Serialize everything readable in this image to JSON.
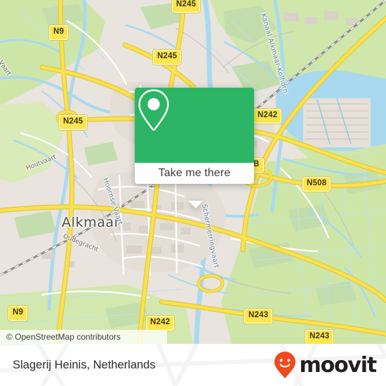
{
  "map": {
    "attribution": "© OpenStreetMap contributors",
    "city_label": "Alkmaar",
    "water_labels": [
      {
        "name": "Kanaal Alkmaar-Kolhorn"
      },
      {
        "name": "Schermerringvaart"
      },
      {
        "name": "Hoornse Vaart"
      },
      {
        "name": "Oudegracht"
      },
      {
        "name": "Houtvaart"
      },
      {
        "name": "ger Vaart"
      }
    ],
    "road_shields": [
      {
        "label": "N245"
      },
      {
        "label": "N9"
      },
      {
        "label": "N245"
      },
      {
        "label": "N245"
      },
      {
        "label": "N242"
      },
      {
        "label": "N508"
      },
      {
        "label": "N9"
      },
      {
        "label": "N242"
      },
      {
        "label": "N243"
      },
      {
        "label": "N243"
      },
      {
        "label": "B"
      }
    ],
    "colors": {
      "land": "#e9e4dd",
      "farmland": "#cde6a8",
      "forest": "#c4ddb0",
      "water": "#a9d9ef",
      "major_road": "#f7d94c",
      "minor_road": "#ffffff",
      "rail": "#7c7c7c"
    }
  },
  "popup": {
    "icon": "map-pin-icon",
    "action_label": "Take me there",
    "accent_color": "#2cb565"
  },
  "footer": {
    "place_name": "Slagerij Heinis, Netherlands",
    "brand_name": "moovit",
    "brand_color": "#ee4a1f"
  }
}
